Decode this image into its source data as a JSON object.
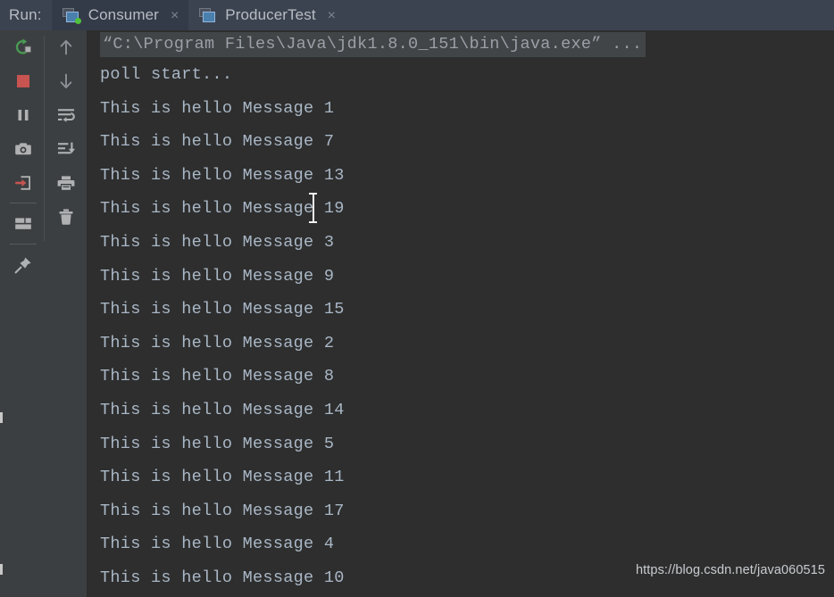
{
  "window": {
    "run_label": "Run:"
  },
  "tabs": [
    {
      "label": "Consumer",
      "icon": "run-window-icon",
      "close": "×",
      "active": true,
      "running": true
    },
    {
      "label": "ProducerTest",
      "icon": "run-window-icon",
      "close": "×",
      "active": false,
      "running": false
    }
  ],
  "toolbar": {
    "left_column": [
      {
        "name": "rerun-button",
        "label": "Rerun",
        "icon": "rerun-icon"
      },
      {
        "name": "stop-button",
        "label": "Stop",
        "icon": "stop-icon"
      },
      {
        "name": "pause-output-button",
        "label": "Pause Output",
        "icon": "pause-icon"
      },
      {
        "name": "screenshot-button",
        "label": "Screenshot",
        "icon": "camera-icon"
      },
      {
        "name": "restore-layout-button",
        "label": "Restore Layout",
        "icon": "arrow-into-box-icon"
      },
      {
        "name": "layout-settings-button",
        "label": "Layout Settings",
        "icon": "layout-icon"
      },
      {
        "name": "pin-tab-button",
        "label": "Pin Tab",
        "icon": "pin-icon"
      }
    ],
    "right_column": [
      {
        "name": "up-button",
        "label": "Up the Stack Trace",
        "icon": "arrow-up-icon"
      },
      {
        "name": "down-button",
        "label": "Down the Stack Trace",
        "icon": "arrow-down-icon"
      },
      {
        "name": "soft-wrap-button",
        "label": "Soft-Wrap",
        "icon": "soft-wrap-icon"
      },
      {
        "name": "scroll-to-end-button",
        "label": "Scroll to End",
        "icon": "scroll-to-end-icon"
      },
      {
        "name": "print-button",
        "label": "Print",
        "icon": "printer-icon"
      },
      {
        "name": "clear-all-button",
        "label": "Clear All",
        "icon": "trash-icon"
      }
    ]
  },
  "console": {
    "command_line": "“C:\\Program Files\\Java\\jdk1.8.0_151\\bin\\java.exe” ...",
    "lines": [
      "poll start...",
      "This is hello Message 1",
      "This is hello Message 7",
      "This is hello Message 13",
      "This is hello Message 19",
      "This is hello Message 3",
      "This is hello Message 9",
      "This is hello Message 15",
      "This is hello Message 2",
      "This is hello Message 8",
      "This is hello Message 14",
      "This is hello Message 5",
      "This is hello Message 11",
      "This is hello Message 17",
      "This is hello Message 4",
      "This is hello Message 10"
    ]
  },
  "watermark": {
    "text": "https://blog.csdn.net/java060515"
  },
  "colors": {
    "tabbar_bg": "#3c4350",
    "active_tab_bg": "#343b48",
    "toolbar_bg": "#3c3f41",
    "console_bg": "#2e2e2e",
    "console_text": "#a9b7c6",
    "command_text": "#9aa0a6",
    "command_highlight": "#414547",
    "run_indicator_green": "#4fc13a",
    "stop_red": "#c75450",
    "rerun_green": "#499c54",
    "icon_gray": "#afb1b3"
  }
}
